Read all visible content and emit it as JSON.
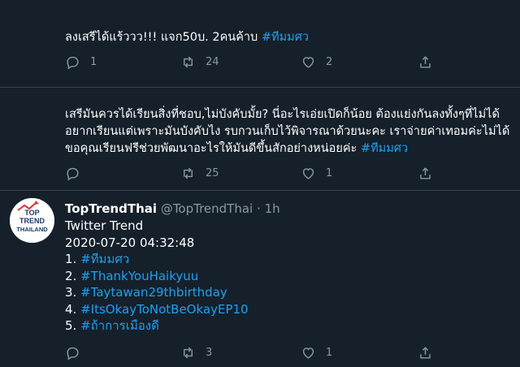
{
  "tweets": [
    {
      "text": "ลงเสรีได้แร้ววว!!! แจก50บ. 2คนค้าบ",
      "hashtag": "#ทีมมศว",
      "replies": "1",
      "retweets": "24",
      "likes": "2"
    },
    {
      "text": "เสรีมันควรได้เรียนสิ่งที่ชอบ,ไม่บังคับมั้ย? นี่อะไรเอ่ยเปิดก็น้อย ต้องแย่งกันลงทั้งๆที่ไม่ได้อยากเรียนแต่เพราะมันบังคับไง รบกวนเก็บไว้พิจารณาด้วยนะคะ เราจ่ายค่าเทอมค่ะไม่ได้ขอคุณเรียนฟรีช่วยพัฒนาอะไรให้มันดีขึ้นสักอย่างหน่อยค่ะ",
      "hashtag": "#ทีมมศว",
      "replies": "",
      "retweets": "25",
      "likes": "1"
    }
  ],
  "bot_tweet": {
    "display_name": "TopTrendThai",
    "handle": "@TopTrendThai",
    "separator": "·",
    "time": "1h",
    "avatar_text": [
      "TOP",
      "TREND",
      "THAILAND"
    ],
    "title": "Twitter Trend",
    "timestamp": "2020-07-20 04:32:48",
    "trends": [
      {
        "rank": "1.",
        "tag": "#ทีมมศว"
      },
      {
        "rank": "2.",
        "tag": "#ThankYouHaikyuu"
      },
      {
        "rank": "3.",
        "tag": "#Taytawan29thbirthday"
      },
      {
        "rank": "4.",
        "tag": "#ItsOkayToNotBeOkayEP10"
      },
      {
        "rank": "5.",
        "tag": "#ถ้าการเมืองดี"
      }
    ],
    "replies": "",
    "retweets": "3",
    "likes": "1"
  },
  "colors": {
    "background": "#15202b",
    "link": "#1da1f2",
    "muted": "#8899a6",
    "divider": "#38444d"
  },
  "icons": {
    "reply": "reply-icon",
    "retweet": "retweet-icon",
    "like": "heart-icon",
    "share": "share-icon"
  }
}
